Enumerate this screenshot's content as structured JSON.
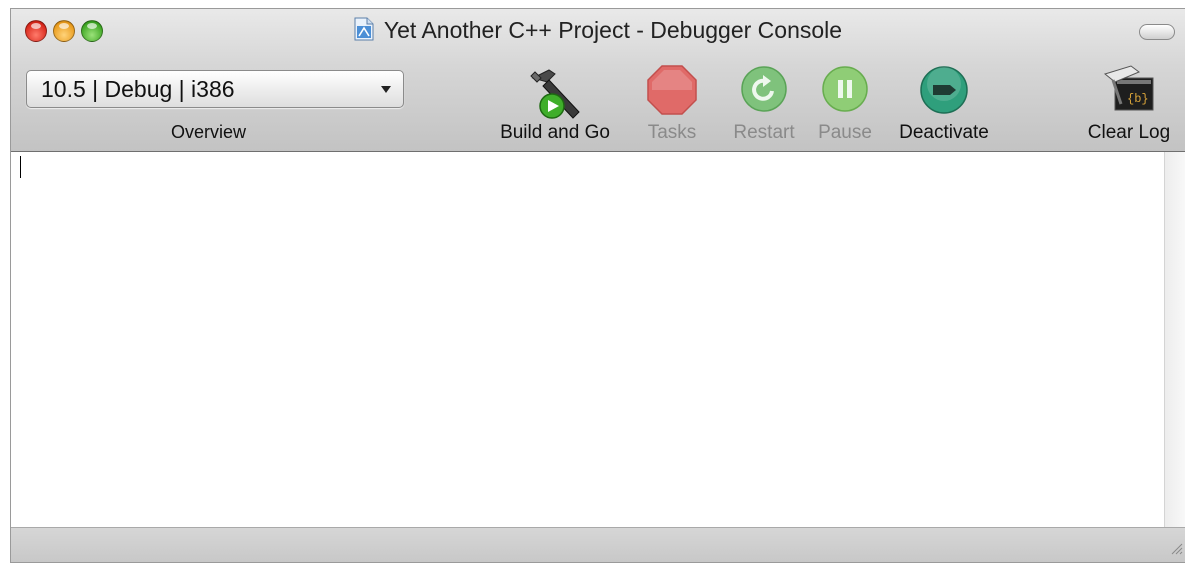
{
  "window": {
    "title": "Yet Another C++ Project - Debugger Console"
  },
  "overview": {
    "selected_value": "10.5 | Debug | i386",
    "label": "Overview"
  },
  "toolbar": {
    "build_and_go": "Build and Go",
    "tasks": "Tasks",
    "restart": "Restart",
    "pause": "Pause",
    "deactivate": "Deactivate",
    "clear_log": "Clear Log"
  },
  "icons": {
    "build_and_go": "hammer-play-icon",
    "tasks": "stop-sign-icon",
    "restart": "restart-icon",
    "pause": "pause-icon",
    "deactivate": "deactivate-icon",
    "clear_log": "clear-log-icon"
  },
  "colors": {
    "tasks_disabled": "#e06a68",
    "restart_disabled": "#7fc27c",
    "pause_disabled": "#8fcd76",
    "deactivate": "#2f9f7c"
  },
  "console": {
    "content": ""
  }
}
